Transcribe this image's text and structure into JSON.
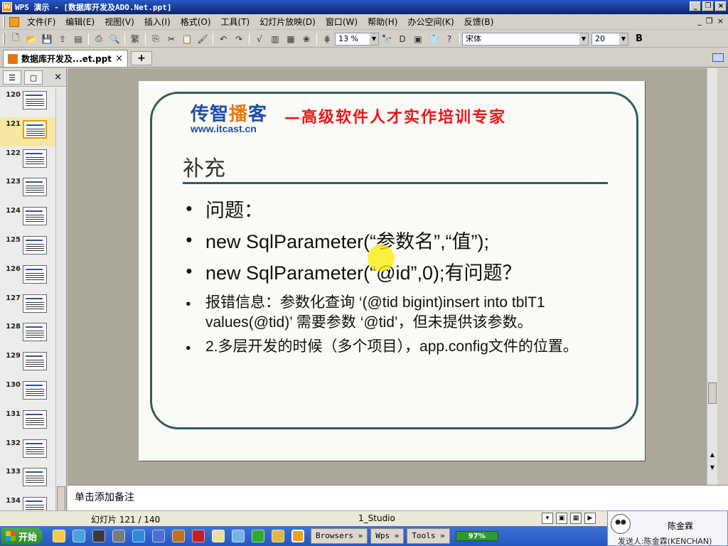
{
  "window": {
    "title": "WPS 演示 - [数据库开发及ADO.Net.ppt]"
  },
  "menu": {
    "items": [
      "文件(F)",
      "编辑(E)",
      "视图(V)",
      "插入(I)",
      "格式(O)",
      "工具(T)",
      "幻灯片放映(D)",
      "窗口(W)",
      "帮助(H)",
      "办公空间(K)",
      "反馈(B)"
    ]
  },
  "toolbar": {
    "zoom": "13 %",
    "font": "宋体",
    "font_size": "20",
    "bold": "B"
  },
  "tabs": {
    "doc_tab_label": "数据库开发及...et.ppt"
  },
  "thumbnails": [
    "120",
    "121",
    "122",
    "123",
    "124",
    "125",
    "126",
    "127",
    "128",
    "129",
    "130",
    "131",
    "132",
    "133",
    "134"
  ],
  "slide": {
    "logo_text": "传智播客",
    "logo_url": "www.itcast.cn",
    "tagline": "—高级软件人才实作培训专家",
    "title": "补充",
    "bullets": [
      "问题：",
      "new SqlParameter(“参数名”,“值”);",
      "new SqlParameter(“@id”,0);有问题？",
      "报错信息：参数化查询 ‘(@tid bigint)insert into tblT1 values(@tid)’ 需要参数 ‘@tid’，但未提供该参数。",
      "2.多层开发的时候（多个项目），app.config文件的位置。"
    ]
  },
  "notes": {
    "placeholder": "单击添加备注"
  },
  "status": {
    "slide_count": "幻灯片 121 / 140",
    "template": "1_Studio"
  },
  "taskbar": {
    "start": "开始",
    "groups": [
      "Browsers",
      "Wps",
      "Tools"
    ],
    "battery": "97%"
  },
  "chat": {
    "name": "陈金霖",
    "message": "发送人:陈金霖(KENCHAN)"
  }
}
